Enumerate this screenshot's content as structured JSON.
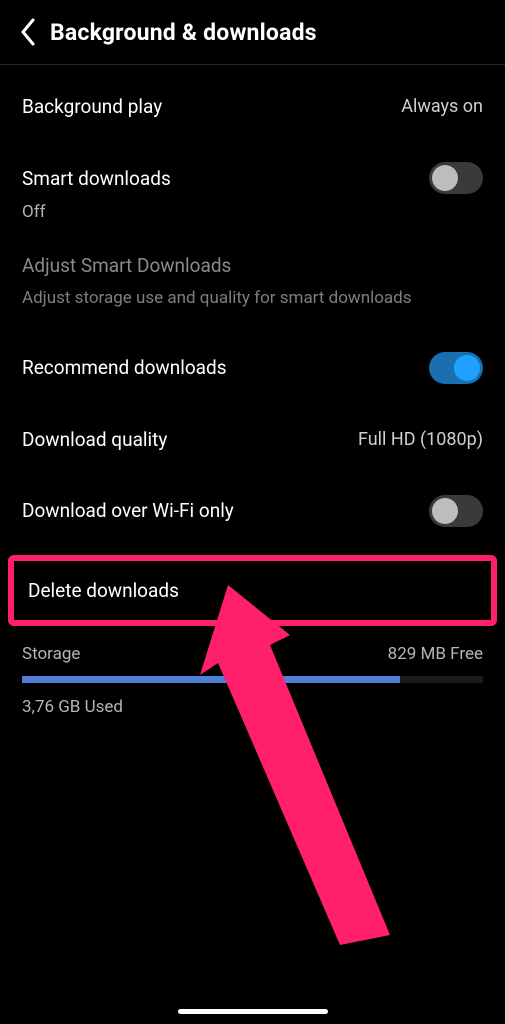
{
  "header": {
    "title": "Background & downloads"
  },
  "rows": {
    "background_play": {
      "label": "Background play",
      "value": "Always on"
    },
    "smart_downloads": {
      "label": "Smart downloads",
      "state_text": "Off"
    },
    "adjust_section": {
      "title": "Adjust Smart Downloads",
      "desc": "Adjust storage use and quality for smart downloads"
    },
    "recommend_downloads": {
      "label": "Recommend downloads"
    },
    "download_quality": {
      "label": "Download quality",
      "value": "Full HD (1080p)"
    },
    "download_wifi_only": {
      "label": "Download over Wi-Fi only"
    },
    "delete_downloads": {
      "label": "Delete downloads"
    }
  },
  "storage": {
    "label": "Storage",
    "free_text": "829 MB Free",
    "used_text": "3,76 GB Used",
    "fill_percent": 82
  },
  "toggles": {
    "smart_downloads_on": false,
    "recommend_downloads_on": true,
    "download_wifi_only_on": false
  },
  "colors": {
    "highlight": "#ff1f6b",
    "toggle_on_track": "#1a6fb0",
    "toggle_on_knob": "#1fa2ff",
    "storage_fill": "#4f7fd6"
  }
}
